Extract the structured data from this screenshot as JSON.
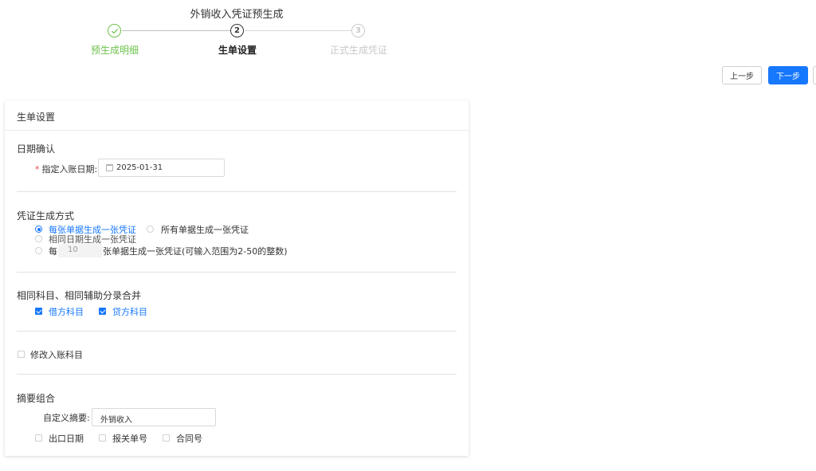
{
  "header": {
    "title": "外销收入凭证预生成"
  },
  "steps": [
    {
      "number": "",
      "label": "预生成明细",
      "status": "done"
    },
    {
      "number": "2",
      "label": "生单设置",
      "status": "current"
    },
    {
      "number": "3",
      "label": "正式生成凭证",
      "status": "pending"
    }
  ],
  "toolbar": {
    "prev_label": "上一步",
    "next_label": "下一步"
  },
  "colors": {
    "primary": "#1677ff",
    "success": "#6cc24a",
    "required": "#e5484d"
  },
  "card": {
    "title": "生单设置",
    "date_section": {
      "title": "日期确认",
      "required_mark": "*",
      "date_label": "指定入账日期:",
      "date_value": "2025-01-31"
    },
    "voucher_section": {
      "title": "凭证生成方式",
      "options": [
        {
          "label": "每张单据生成一张凭证",
          "checked": true
        },
        {
          "label": "所有单据生成一张凭证",
          "checked": false
        },
        {
          "label": "相同日期生成一张凭证",
          "checked": false
        }
      ],
      "per_n": {
        "prefix": "每",
        "value": "10",
        "suffix": "张单据生成一张凭证(可输入范围为2-50的整数)",
        "checked": false
      }
    },
    "merge_section": {
      "title": "相同科目、相同辅助分录合并",
      "debit_label": "借方科目",
      "debit_checked": true,
      "credit_label": "贷方科目",
      "credit_checked": true
    },
    "modify_account": {
      "label": "修改入账科目",
      "checked": false
    },
    "summary_section": {
      "title": "摘要组合",
      "custom_label": "自定义摘要:",
      "custom_value": "外销收入",
      "options": [
        {
          "label": "出口日期",
          "checked": false
        },
        {
          "label": "报关单号",
          "checked": false
        },
        {
          "label": "合同号",
          "checked": false
        }
      ]
    }
  }
}
